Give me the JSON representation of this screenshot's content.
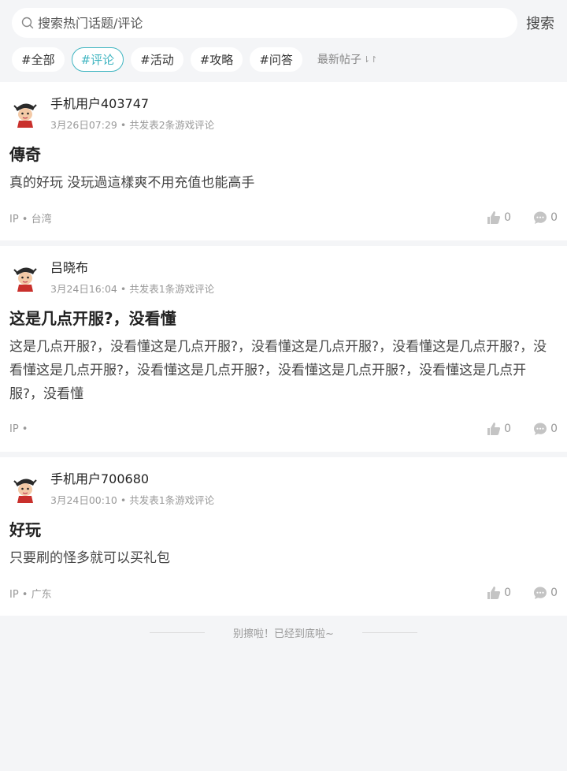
{
  "search": {
    "placeholder": "搜索热门话题/评论",
    "button": "搜索"
  },
  "tags": [
    "#全部",
    "#评论",
    "#活动",
    "#攻略",
    "#问答"
  ],
  "sort_label": "最新帖子",
  "posts": [
    {
      "user": "手机用户403747",
      "meta": "3月26日07:29 • 共发表2条游戏评论",
      "title": "傳奇",
      "body": "真的好玩 没玩過這樣爽不用充值也能高手",
      "ip": "IP • 台湾",
      "likes": "0",
      "comments": "0"
    },
    {
      "user": "吕晓布",
      "meta": "3月24日16:04 • 共发表1条游戏评论",
      "title": "这是几点开服?，没看懂",
      "body": "这是几点开服?，没看懂这是几点开服?，没看懂这是几点开服?，没看懂这是几点开服?，没看懂这是几点开服?，没看懂这是几点开服?，没看懂这是几点开服?，没看懂这是几点开服?，没看懂",
      "ip": "IP •",
      "likes": "0",
      "comments": "0"
    },
    {
      "user": "手机用户700680",
      "meta": "3月24日00:10 • 共发表1条游戏评论",
      "title": "好玩",
      "body": "只要刷的怪多就可以买礼包",
      "ip": "IP • 广东",
      "likes": "0",
      "comments": "0"
    }
  ],
  "end_text": "别擦啦！已经到底啦~"
}
